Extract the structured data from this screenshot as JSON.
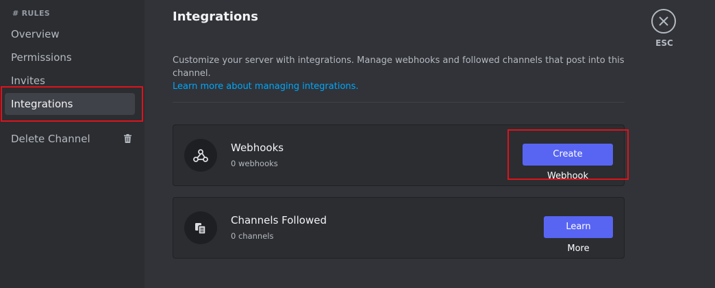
{
  "sidebar": {
    "header": "# RULES",
    "items": [
      {
        "label": "Overview"
      },
      {
        "label": "Permissions"
      },
      {
        "label": "Invites"
      },
      {
        "label": "Integrations"
      }
    ],
    "delete_label": "Delete Channel"
  },
  "main": {
    "title": "Integrations",
    "description": "Customize your server with integrations. Manage webhooks and followed channels that post into this channel.",
    "learn_more_link": "Learn more about managing integrations.",
    "webhooks": {
      "title": "Webhooks",
      "count": "0 webhooks",
      "button": "Create Webhook",
      "icon": "webhook-icon"
    },
    "channels_followed": {
      "title": "Channels Followed",
      "count": "0 channels",
      "button": "Learn More",
      "icon": "channel-follow-icon"
    }
  },
  "close": {
    "label": "ESC",
    "icon": "close-icon"
  },
  "colors": {
    "accent": "#5865f2",
    "link": "#00a8fc",
    "highlight": "#e0121b"
  }
}
